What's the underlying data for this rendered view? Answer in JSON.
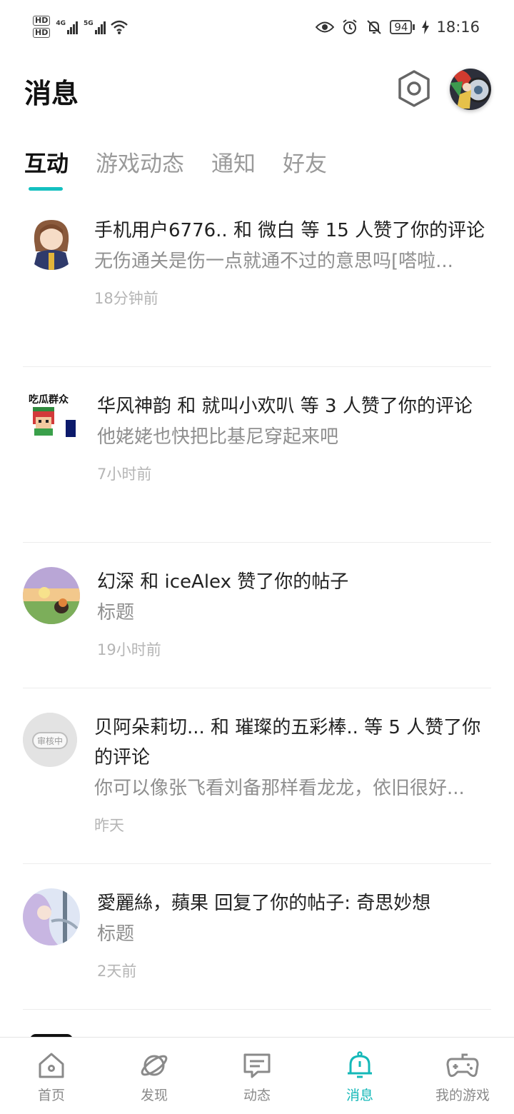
{
  "status_bar": {
    "hd1": "HD",
    "hd2": "HD",
    "net1": "4G",
    "net2": "5G",
    "battery": "94",
    "time": "18:16"
  },
  "header": {
    "title": "消息"
  },
  "tabs": [
    {
      "label": "互动",
      "active": true
    },
    {
      "label": "游戏动态",
      "active": false
    },
    {
      "label": "通知",
      "active": false
    },
    {
      "label": "好友",
      "active": false
    }
  ],
  "messages": [
    {
      "title": "手机用户6776.. 和 微白 等 15 人赞了你的评论",
      "snippet": "无伤通关是伤一点就通不过的意思吗[嗒啦...",
      "time": "18分钟前"
    },
    {
      "title": "华风神韵 和 就叫小欢叭 等 3 人赞了你的评论",
      "snippet": "他姥姥也快把比基尼穿起来吧",
      "time": "7小时前",
      "avatar_text": "吃瓜群众"
    },
    {
      "title": "幻深 和 iceAlex 赞了你的帖子",
      "snippet": "标题",
      "time": "19小时前"
    },
    {
      "title": "贝阿朵莉切... 和 璀璨的五彩棒.. 等 5 人赞了你的评论",
      "snippet": "你可以像张飞看刘备那样看龙龙，依旧很好...",
      "time": "昨天",
      "avatar_text": "审核中"
    },
    {
      "title": "愛麗絲，蘋果 回复了你的帖子: 奇思妙想",
      "snippet": "标题",
      "time": "2天前"
    }
  ],
  "bottom_nav": [
    {
      "label": "首页",
      "icon": "home-icon",
      "active": false
    },
    {
      "label": "发现",
      "icon": "planet-icon",
      "active": false
    },
    {
      "label": "动态",
      "icon": "chat-icon",
      "active": false
    },
    {
      "label": "消息",
      "icon": "bell-icon",
      "active": true
    },
    {
      "label": "我的游戏",
      "icon": "gamepad-icon",
      "active": false
    }
  ],
  "colors": {
    "accent": "#14c0c0",
    "muted_text": "#8f8f8f",
    "time_text": "#b5b5b5"
  }
}
